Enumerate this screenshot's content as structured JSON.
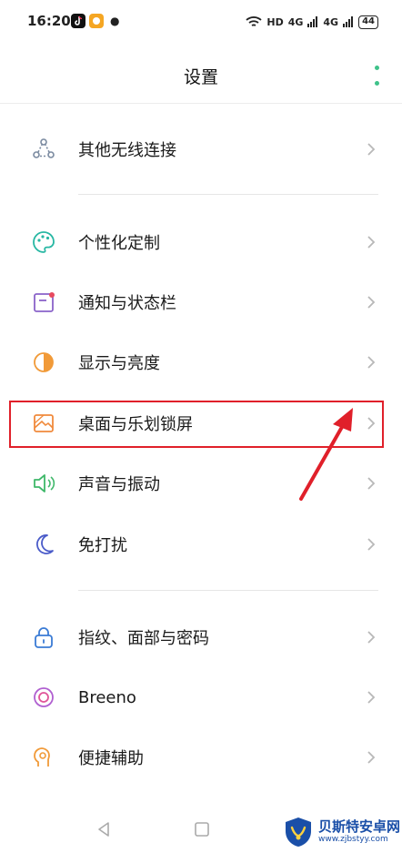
{
  "status_bar": {
    "time": "16:20",
    "network": "HD",
    "signal_1": "4G",
    "signal_2": "4G",
    "battery": "44"
  },
  "header": {
    "title": "设置"
  },
  "settings": [
    {
      "label": "其他无线连接",
      "icon": "share-nodes-icon"
    },
    {
      "label": "个性化定制",
      "icon": "palette-icon"
    },
    {
      "label": "通知与状态栏",
      "icon": "notification-icon"
    },
    {
      "label": "显示与亮度",
      "icon": "brightness-icon"
    },
    {
      "label": "桌面与乐划锁屏",
      "icon": "wallpaper-icon"
    },
    {
      "label": "声音与振动",
      "icon": "speaker-icon"
    },
    {
      "label": "免打扰",
      "icon": "moon-icon"
    },
    {
      "label": "指纹、面部与密码",
      "icon": "lock-icon"
    },
    {
      "label": "Breeno",
      "icon": "breeno-icon"
    },
    {
      "label": "便捷辅助",
      "icon": "assist-icon"
    }
  ],
  "watermark": {
    "name": "贝斯特安卓网",
    "url": "www.zjbstyy.com"
  },
  "colors": {
    "highlight": "#e0202a",
    "accent": "#3fc28a"
  }
}
